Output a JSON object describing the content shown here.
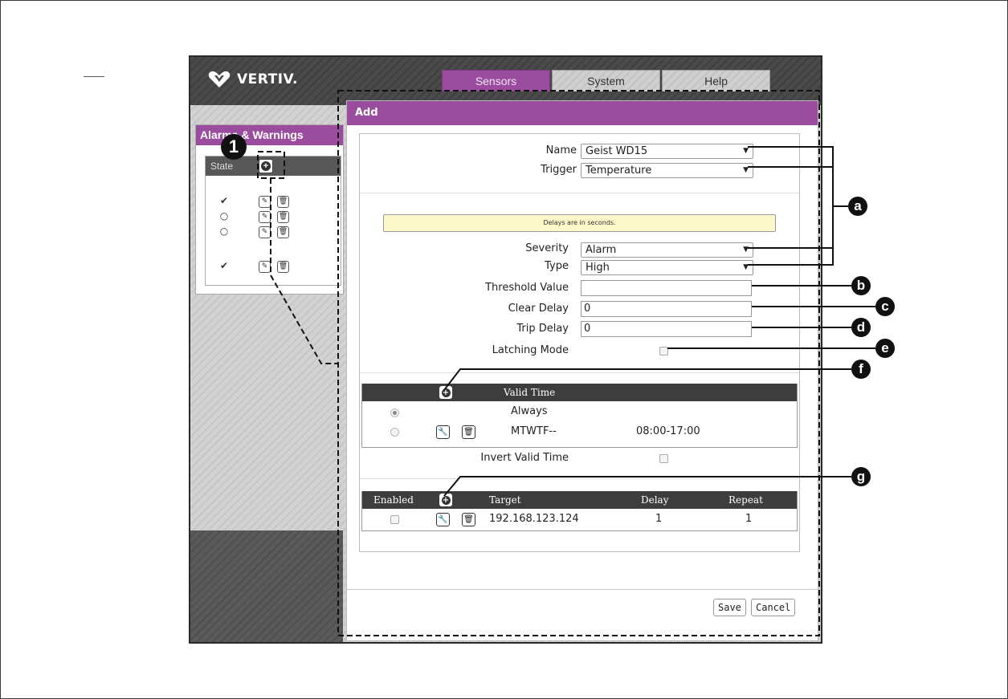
{
  "app": {
    "logo_text": "VERTIV.",
    "tabs": [
      {
        "label": "Sensors",
        "active": true
      },
      {
        "label": "System",
        "active": false
      },
      {
        "label": "Help",
        "active": false
      }
    ]
  },
  "sidebar": {
    "title": "Alarms & Warnings",
    "state_header": "State",
    "rows": [
      {
        "state": "✔"
      },
      {
        "state": "○"
      },
      {
        "state": "○"
      },
      {
        "state": "✔"
      }
    ]
  },
  "dialog": {
    "title": "Add",
    "name_label": "Name",
    "name_value": "Geist WD15",
    "trigger_label": "Trigger",
    "trigger_value": "Temperature",
    "notice": "Delays are in seconds.",
    "severity_label": "Severity",
    "severity_value": "Alarm",
    "type_label": "Type",
    "type_value": "High",
    "threshold_label": "Threshold Value",
    "threshold_value": "",
    "clear_delay_label": "Clear Delay",
    "clear_delay_value": "0",
    "trip_delay_label": "Trip Delay",
    "trip_delay_value": "0",
    "latching_label": "Latching Mode",
    "valid_time": {
      "header": "Valid Time",
      "rows": [
        {
          "label": "Always",
          "time": "",
          "selected": true
        },
        {
          "label": "MTWTF--",
          "time": "08:00-17:00",
          "selected": false
        }
      ]
    },
    "invert_label": "Invert Valid Time",
    "actions": {
      "headers": {
        "enabled": "Enabled",
        "target": "Target",
        "delay": "Delay",
        "repeat": "Repeat"
      },
      "rows": [
        {
          "target": "192.168.123.124",
          "delay": "1",
          "repeat": "1"
        }
      ]
    },
    "save_label": "Save",
    "cancel_label": "Cancel"
  },
  "callouts": {
    "step": "1",
    "a": "a",
    "b": "b",
    "c": "c",
    "d": "d",
    "e": "e",
    "f": "f",
    "g": "g"
  },
  "colors": {
    "accent": "#9a4d9e",
    "topbar": "#444444",
    "grid_header": "#3d3d3d",
    "notice_bg": "#fcf8c9"
  }
}
